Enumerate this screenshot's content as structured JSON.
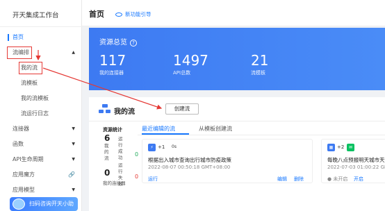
{
  "sidebar": {
    "brand": "开天集成工作台",
    "items": [
      {
        "label": "首页"
      },
      {
        "label": "流编排"
      },
      {
        "label": "连接器"
      },
      {
        "label": "函数"
      },
      {
        "label": "API生命周期"
      },
      {
        "label": "应用魔方"
      },
      {
        "label": "应用模型"
      }
    ],
    "sub_items": [
      {
        "label": "我的流"
      },
      {
        "label": "流模板"
      },
      {
        "label": "我的流模板"
      },
      {
        "label": "流运行日志"
      }
    ],
    "promo": "扫码咨询开天小助手"
  },
  "header": {
    "title": "首页",
    "guide": "新功能引导"
  },
  "overview": {
    "title": "资源总览",
    "help_icon": "?",
    "stats": [
      {
        "value": "117",
        "label": "我的连接器"
      },
      {
        "value": "1497",
        "label": "API总数"
      },
      {
        "value": "21",
        "label": "流模板"
      }
    ]
  },
  "flows": {
    "title": "我的流",
    "create_label": "创建流",
    "resource_stats": {
      "title": "资源统计",
      "flow_count": "6",
      "flow_label": "我的流",
      "running_success_label": "运行成功",
      "running_success_value": "0",
      "running_fail_label": "运行失败",
      "running_fail_value": "0",
      "connector_count": "0",
      "connector_label": "我的连接器"
    },
    "tabs": [
      {
        "label": "最近编辑的流"
      },
      {
        "label": "从模板创建流"
      }
    ],
    "cards": [
      {
        "plus": "+1",
        "badge": "0s",
        "title": "根据出入城市查询出行城市防疫政策",
        "date": "2022-08-07 00:50:18 GMT+08:00",
        "footer": "运行",
        "edit": "编辑",
        "delete": "删除"
      },
      {
        "plus": "+2",
        "title": "每晚八点预报明天城市天气情",
        "date": "2022-07-03 01:00:22 GMT+",
        "status": "未开启",
        "enable": "开启"
      }
    ]
  },
  "colors": {
    "accent": "#1677ff",
    "banner": "#3d7af2",
    "annotation_red": "#e53935",
    "success": "#27ae60"
  }
}
